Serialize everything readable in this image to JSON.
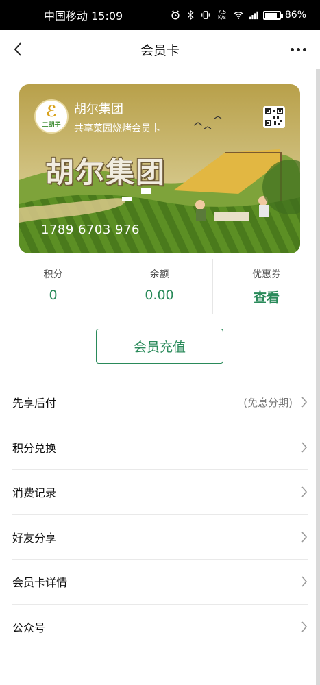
{
  "status_bar": {
    "carrier_time": "中国移动 15:09",
    "net_speed_top": "7.5",
    "net_speed_unit": "K/s",
    "battery": "86%"
  },
  "nav": {
    "title": "会员卡"
  },
  "card": {
    "logo_text": "二胡子",
    "name": "胡尔集团",
    "subtitle": "共享菜园烧烤会员卡",
    "big_title": "胡尔集团",
    "number": "1789 6703 976"
  },
  "stats": [
    {
      "label": "积分",
      "value": "0"
    },
    {
      "label": "余额",
      "value": "0.00"
    },
    {
      "label": "优惠券",
      "value": "查看"
    }
  ],
  "recharge_label": "会员充值",
  "menu": [
    {
      "label": "先享后付",
      "note": "(免息分期)"
    },
    {
      "label": "积分兑换"
    },
    {
      "label": "消费记录"
    },
    {
      "label": "好友分享"
    },
    {
      "label": "会员卡详情"
    },
    {
      "label": "公众号"
    }
  ],
  "colors": {
    "accent": "#2a8a5a",
    "status_bar": "#000000"
  }
}
